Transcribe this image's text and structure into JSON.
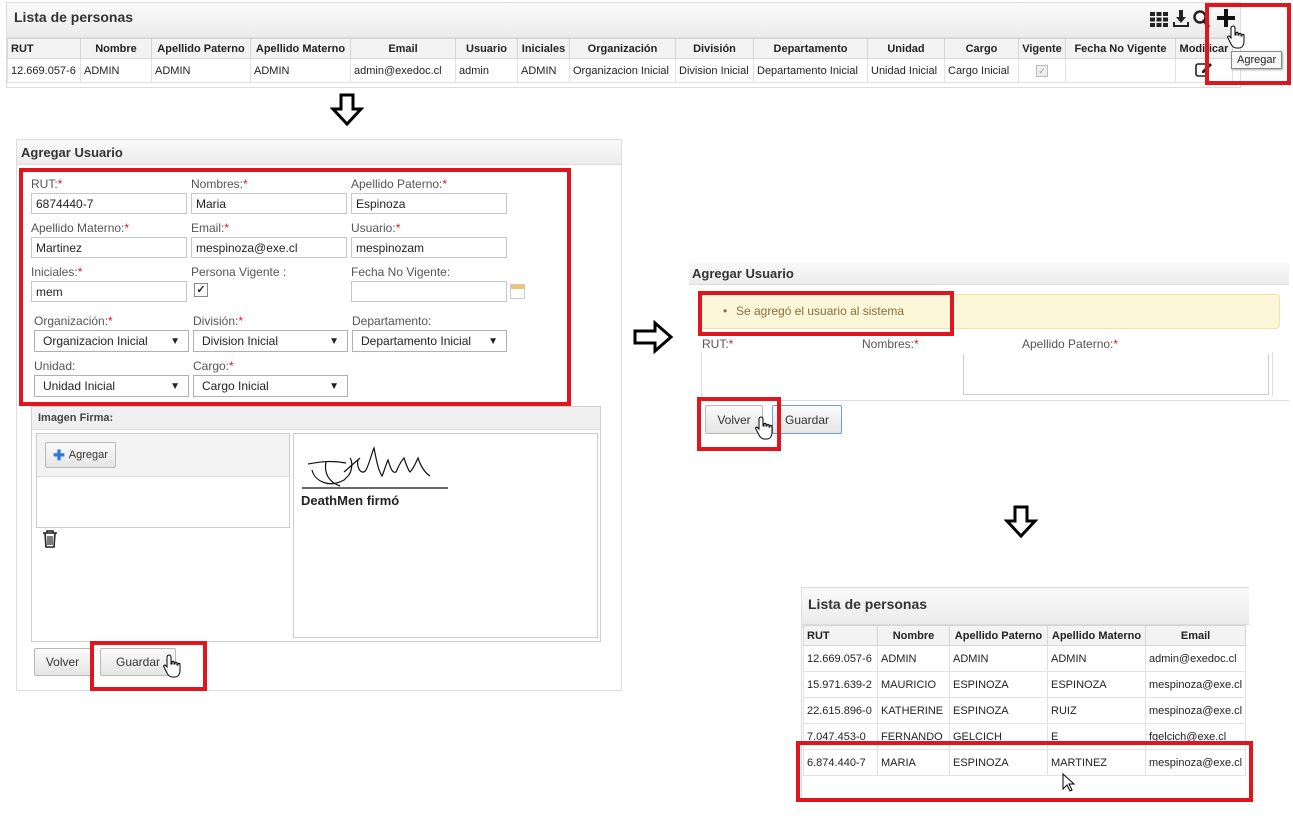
{
  "top": {
    "title": "Lista de personas",
    "columns": [
      "RUT",
      "Nombre",
      "Apellido Paterno",
      "Apellido Materno",
      "Email",
      "Usuario",
      "Iniciales",
      "Organización",
      "División",
      "Departamento",
      "Unidad",
      "Cargo",
      "Vigente",
      "Fecha No Vigente",
      "Modificar"
    ],
    "row": [
      "12.669.057-6",
      "ADMIN",
      "ADMIN",
      "ADMIN",
      "admin@exedoc.cl",
      "admin",
      "ADMIN",
      "Organizacion Inicial",
      "Division Inicial",
      "Departamento Inicial",
      "Unidad Inicial",
      "Cargo Inicial",
      "",
      "",
      ""
    ],
    "tooltip": "Agregar",
    "icons": [
      "columns-icon",
      "download-icon",
      "search-icon",
      "plus-icon"
    ]
  },
  "form": {
    "title": "Agregar Usuario",
    "rut_label": "RUT:",
    "rut_value": "6874440-7",
    "nombres_label": "Nombres:",
    "nombres_value": "Maria",
    "apat_label": "Apellido Paterno:",
    "apat_value": "Espinoza",
    "amat_label": "Apellido Materno:",
    "amat_value": "Martinez",
    "email_label": "Email:",
    "email_value": "mespinoza@exe.cl",
    "usuario_label": "Usuario:",
    "usuario_value": "mespinozam",
    "iniciales_label": "Iniciales:",
    "iniciales_value": "mem",
    "vigente_label": "Persona Vigente :",
    "fecha_label": "Fecha No Vigente:",
    "org_label": "Organización:",
    "org_value": "Organizacion Inicial",
    "div_label": "División:",
    "div_value": "Division Inicial",
    "dep_label": "Departamento:",
    "dep_value": "Departamento Inicial",
    "unidad_label": "Unidad:",
    "unidad_value": "Unidad Inicial",
    "cargo_label": "Cargo:",
    "cargo_value": "Cargo Inicial",
    "required_mark": "*",
    "firma_title": "Imagen Firma:",
    "agregar_label": "Agregar",
    "signature_caption": "DeathMen firmó",
    "volver_label": "Volver",
    "guardar_label": "Guardar"
  },
  "success": {
    "title": "Agregar Usuario",
    "message": "Se agregó el usuario al sistema",
    "rut_label": "RUT:",
    "nombres_label": "Nombres:",
    "apat_label": "Apellido Paterno:",
    "volver_label": "Volver",
    "guardar_label": "Guardar"
  },
  "result": {
    "title": "Lista de personas",
    "columns": [
      "RUT",
      "Nombre",
      "Apellido Paterno",
      "Apellido Materno",
      "Email"
    ],
    "rows": [
      [
        "12.669.057-6",
        "ADMIN",
        "ADMIN",
        "ADMIN",
        "admin@exedoc.cl"
      ],
      [
        "15.971.639-2",
        "MAURICIO",
        "ESPINOZA",
        "ESPINOZA",
        "mespinoza@exe.cl"
      ],
      [
        "22.615.896-0",
        "KATHERINE",
        "ESPINOZA",
        "RUIZ",
        "mespinoza@exe.cl"
      ],
      [
        "7.047.453-0",
        "FERNANDO",
        "GELCICH",
        "E",
        "fgelcich@exe.cl"
      ],
      [
        "6.874.440-7",
        "MARIA",
        "ESPINOZA",
        "MARTINEZ",
        "mespinoza@exe.cl"
      ]
    ]
  },
  "colors": {
    "highlight": "#e0161f",
    "success_bg": "#fcf7d8"
  }
}
